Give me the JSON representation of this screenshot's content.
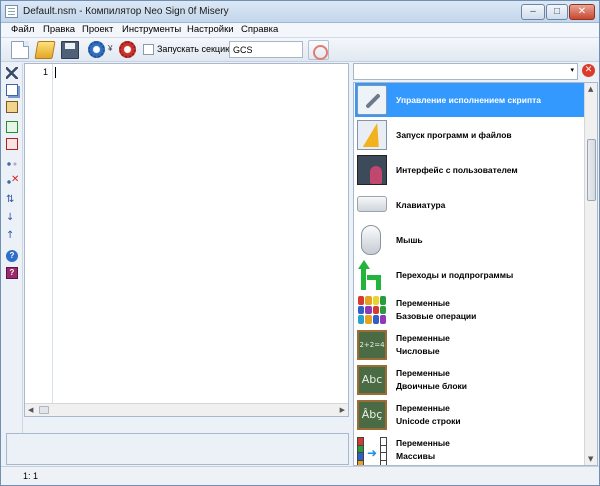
{
  "window": {
    "title": "Default.nsm - Компилятор Neo Sign 0f Misery",
    "minimize": "–",
    "maximize": "□",
    "close": "✕"
  },
  "menu": [
    "Файл",
    "Правка",
    "Проект",
    "Инструменты",
    "Настройки",
    "Справка"
  ],
  "toolbar": {
    "new_icon": "new-file-icon",
    "open_icon": "open-folder-icon",
    "save_icon": "save-disk-icon",
    "compile_icon": "gear-blue-icon",
    "run_icon": "gear-red-icon",
    "dropdown_arrow": "¥",
    "section_checkbox_label": "Запускать секцию",
    "section_checkbox_checked": false,
    "section_name": "GCS",
    "jump_icon": "target-icon"
  },
  "left_toolbar": [
    "cut-icon",
    "copy-icon",
    "paste-icon",
    "add-page-icon",
    "delete-page-icon",
    "insert-line-icon",
    "delete-line-icon",
    "swap-lines-icon",
    "move-down-icon",
    "move-up-icon",
    "help-icon",
    "book-icon"
  ],
  "editor": {
    "line_numbers": [
      "1"
    ],
    "text": ""
  },
  "status": {
    "position": "1:  1"
  },
  "command_panel": {
    "filter_value": "",
    "dropdown_arrow": "▾",
    "clear_label": "✕",
    "items": [
      {
        "line1": "Управление исполнением скрипта",
        "line2": "",
        "icon": "wrench-icon",
        "selected": true
      },
      {
        "line1": "Запуск программ и файлов",
        "line2": "",
        "icon": "lightning-icon",
        "selected": false
      },
      {
        "line1": "Интерфейс с пользователем",
        "line2": "",
        "icon": "user-interface-icon",
        "selected": false
      },
      {
        "line1": "Клавиатура",
        "line2": "",
        "icon": "keyboard-icon",
        "selected": false
      },
      {
        "line1": "Мышь",
        "line2": "",
        "icon": "mouse-icon",
        "selected": false
      },
      {
        "line1": "Переходы и подпрограммы",
        "line2": "",
        "icon": "jump-arrow-icon",
        "selected": false
      },
      {
        "line1": "Переменные",
        "line2": "Базовые операции",
        "icon": "color-blocks-icon",
        "selected": false
      },
      {
        "line1": "Переменные",
        "line2": "Числовые",
        "icon": "chalkboard-numbers-icon",
        "selected": false
      },
      {
        "line1": "Переменные",
        "line2": "Двоичные блоки",
        "icon": "chalkboard-abc-icon",
        "selected": false
      },
      {
        "line1": "Переменные",
        "line2": "Unicode строки",
        "icon": "chalkboard-unicode-icon",
        "selected": false
      },
      {
        "line1": "Переменные",
        "line2": "Массивы",
        "icon": "array-icon",
        "selected": false
      }
    ],
    "board_texts": [
      "2+2=4",
      "Abc",
      "Âbç"
    ]
  }
}
